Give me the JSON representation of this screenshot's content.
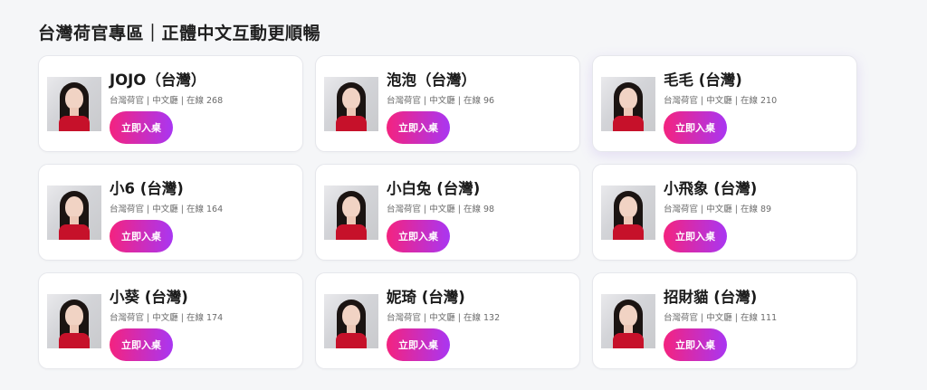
{
  "section": {
    "title": "台灣荷官專區｜正體中文互動更順暢"
  },
  "cards": [
    {
      "name": "JOJO（台灣）",
      "meta": "台灣荷官 | 中文廳 | 在線 268",
      "button": "立即入桌"
    },
    {
      "name": "泡泡（台灣）",
      "meta": "台灣荷官 | 中文廳 | 在線 96",
      "button": "立即入桌"
    },
    {
      "name": "毛毛 (台灣)",
      "meta": "台灣荷官 | 中文廳 | 在線 210",
      "button": "立即入桌"
    },
    {
      "name": "小6 (台灣)",
      "meta": "台灣荷官 | 中文廳 | 在線 164",
      "button": "立即入桌"
    },
    {
      "name": "小白兔 (台灣)",
      "meta": "台灣荷官 | 中文廳 | 在線 98",
      "button": "立即入桌"
    },
    {
      "name": "小飛象 (台灣)",
      "meta": "台灣荷官 | 中文廳 | 在線 89",
      "button": "立即入桌"
    },
    {
      "name": "小葵 (台灣)",
      "meta": "台灣荷官 | 中文廳 | 在線 174",
      "button": "立即入桌"
    },
    {
      "name": "妮琦 (台灣)",
      "meta": "台灣荷官 | 中文廳 | 在線 132",
      "button": "立即入桌"
    },
    {
      "name": "招財貓 (台灣)",
      "meta": "台灣荷官 | 中文廳 | 在線 111",
      "button": "立即入桌"
    }
  ],
  "colors": {
    "button_gradient_start": "#f4237f",
    "button_gradient_end": "#a936f2",
    "dress": "#c6112a"
  }
}
